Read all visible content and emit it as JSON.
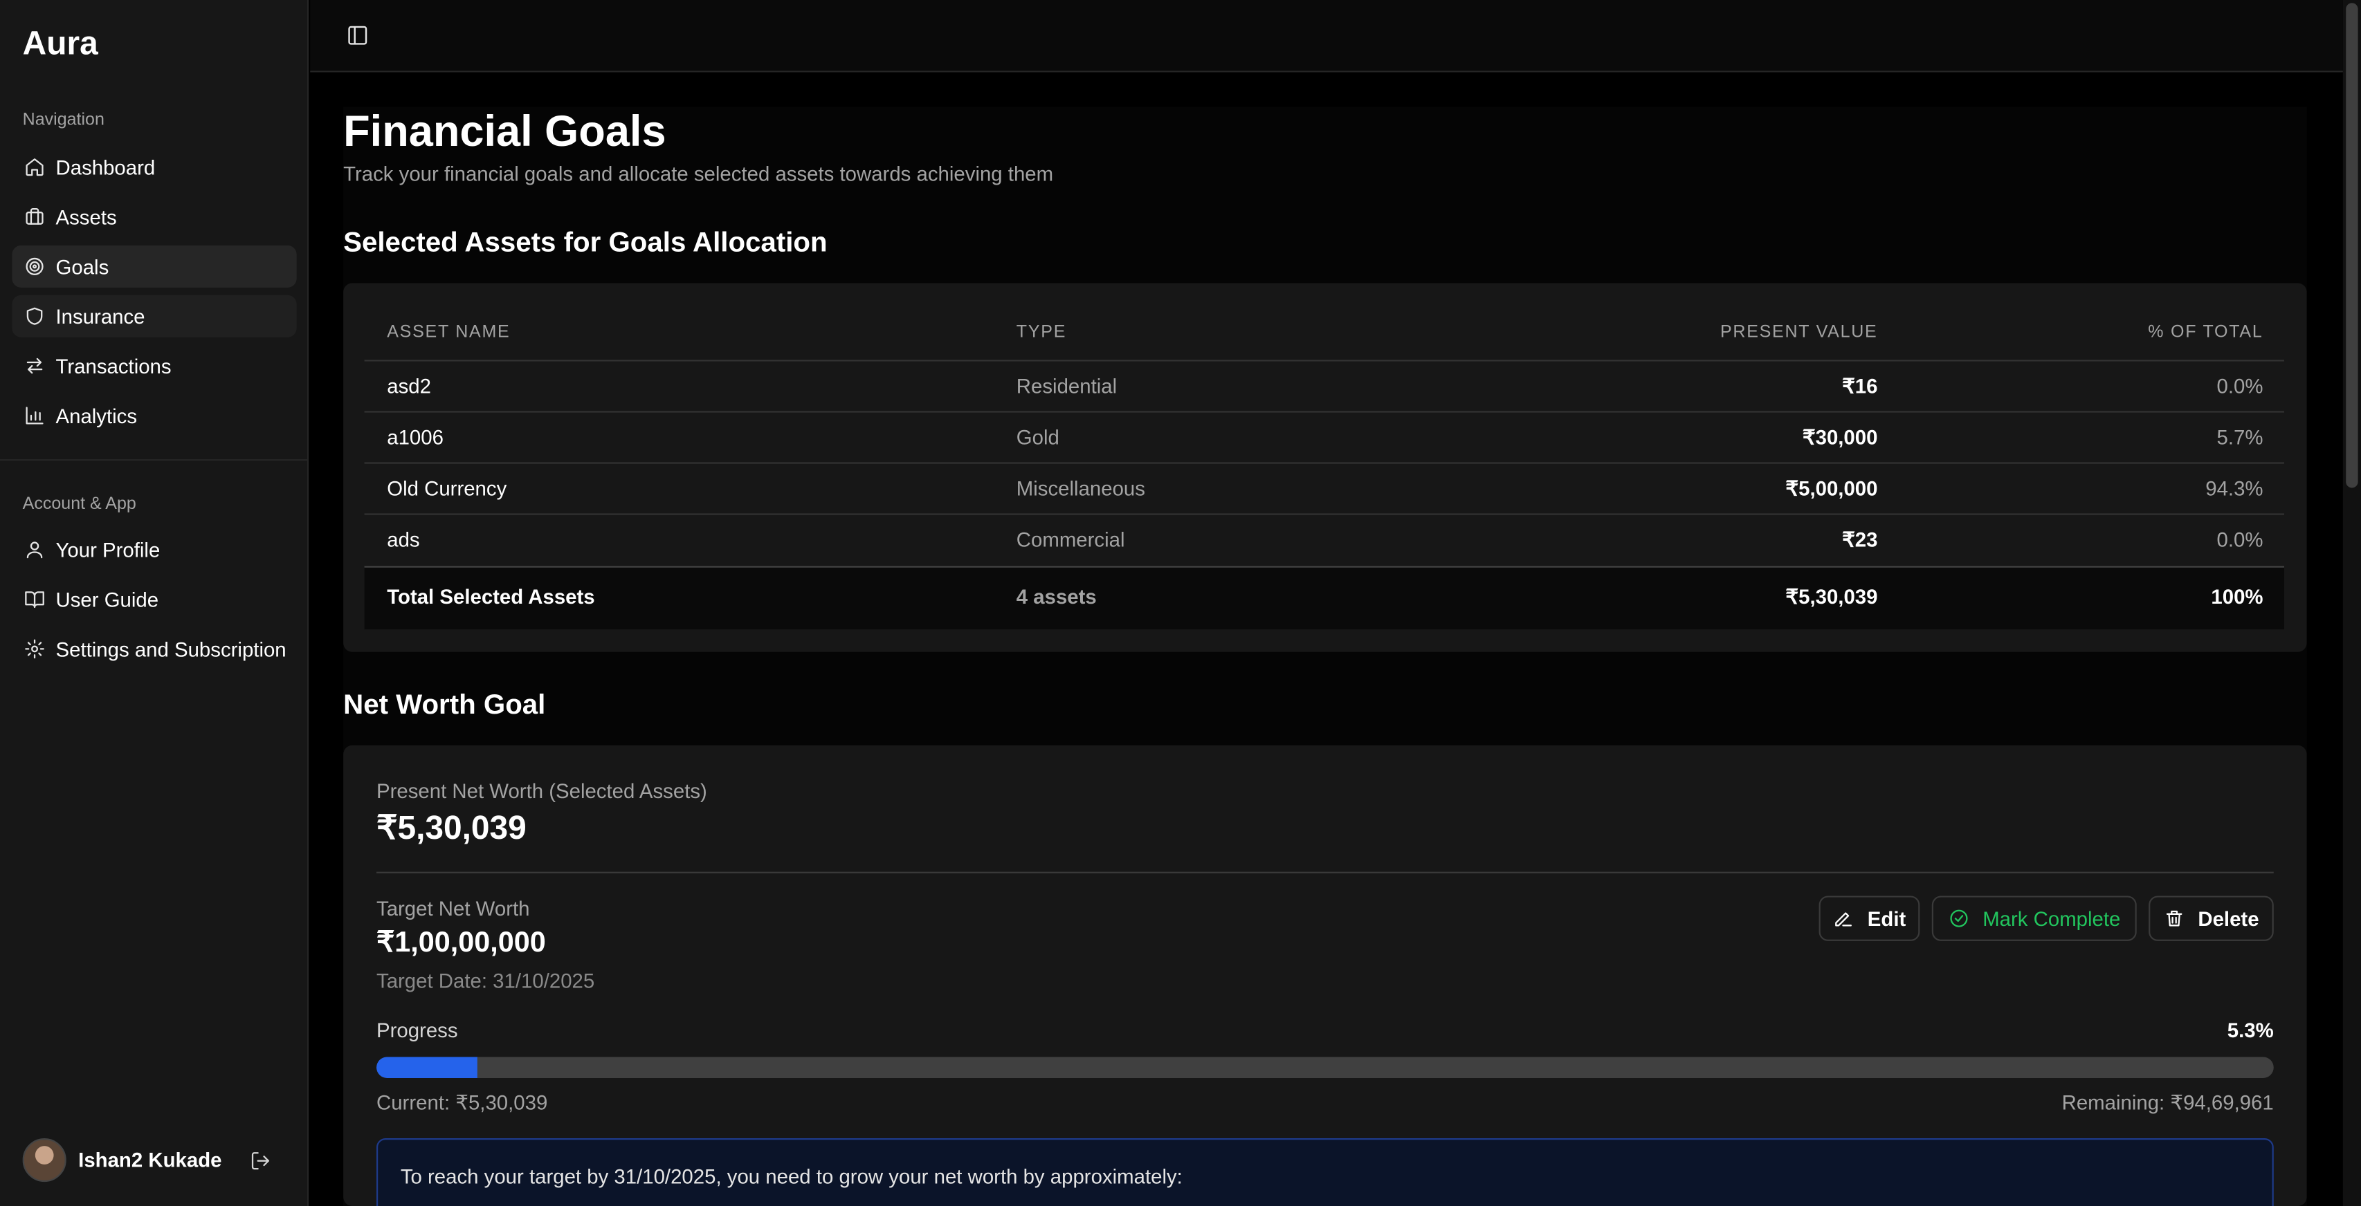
{
  "app": {
    "brand": "Aura"
  },
  "sidebar": {
    "nav_label": "Navigation",
    "nav_items": [
      {
        "label": "Dashboard",
        "icon": "home-icon"
      },
      {
        "label": "Assets",
        "icon": "briefcase-icon"
      },
      {
        "label": "Goals",
        "icon": "target-icon",
        "active": true
      },
      {
        "label": "Insurance",
        "icon": "shield-icon"
      },
      {
        "label": "Transactions",
        "icon": "arrows-exchange-icon"
      },
      {
        "label": "Analytics",
        "icon": "bar-chart-icon"
      }
    ],
    "account_label": "Account & App",
    "account_items": [
      {
        "label": "Your Profile",
        "icon": "user-icon"
      },
      {
        "label": "User Guide",
        "icon": "book-open-icon"
      },
      {
        "label": "Settings and Subscription",
        "icon": "gear-icon"
      }
    ],
    "user": {
      "name": "Ishan2 Kukade"
    }
  },
  "page": {
    "title": "Financial Goals",
    "subtitle": "Track your financial goals and allocate selected assets towards achieving them"
  },
  "assets_section": {
    "title": "Selected Assets for Goals Allocation",
    "columns": [
      "ASSET NAME",
      "TYPE",
      "PRESENT VALUE",
      "% OF TOTAL"
    ],
    "rows": [
      {
        "name": "asd2",
        "type": "Residential",
        "value": "₹16",
        "pct": "0.0%"
      },
      {
        "name": "a1006",
        "type": "Gold",
        "value": "₹30,000",
        "pct": "5.7%"
      },
      {
        "name": "Old Currency",
        "type": "Miscellaneous",
        "value": "₹5,00,000",
        "pct": "94.3%"
      },
      {
        "name": "ads",
        "type": "Commercial",
        "value": "₹23",
        "pct": "0.0%"
      }
    ],
    "total": {
      "name": "Total Selected Assets",
      "type": "4 assets",
      "value": "₹5,30,039",
      "pct": "100%"
    }
  },
  "net_worth_goal": {
    "title": "Net Worth Goal",
    "present_label": "Present Net Worth (Selected Assets)",
    "present_value": "₹5,30,039",
    "target_label": "Target Net Worth",
    "target_value": "₹1,00,00,000",
    "target_date": "Target Date: 31/10/2025",
    "buttons": {
      "edit": "Edit",
      "complete": "Mark Complete",
      "delete": "Delete"
    },
    "progress_label": "Progress",
    "progress_pct_text": "5.3%",
    "progress_fraction": 0.053,
    "current_text": "Current: ₹5,30,039",
    "remaining_text": "Remaining: ₹94,69,961",
    "info_text": "To reach your target by 31/10/2025, you need to grow your net worth by approximately:"
  },
  "colors": {
    "accent": "#2563eb",
    "success": "#22c55e",
    "bg": "#000000",
    "card": "#171717"
  }
}
